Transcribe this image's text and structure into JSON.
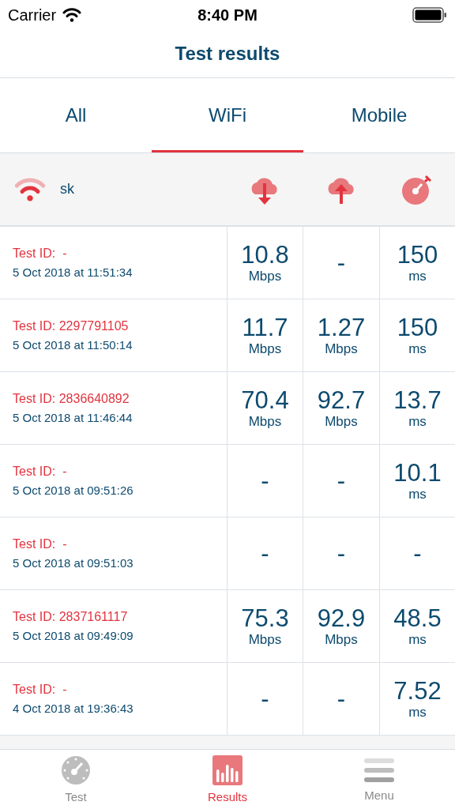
{
  "status_bar": {
    "carrier": "Carrier",
    "time": "8:40 PM"
  },
  "title": "Test results",
  "tabs": [
    {
      "label": "All",
      "selected": false
    },
    {
      "label": "WiFi",
      "selected": true
    },
    {
      "label": "Mobile",
      "selected": false
    }
  ],
  "network": {
    "name": "sk"
  },
  "rows": [
    {
      "test_id": "Test ID:  -",
      "date": "5 Oct 2018 at 11:51:34",
      "cells": [
        {
          "value": "10.8",
          "unit": "Mbps"
        },
        {
          "value": "-"
        },
        {
          "value": "150",
          "unit": "ms"
        }
      ]
    },
    {
      "test_id": "Test ID: 2297791105",
      "date": "5 Oct 2018 at 11:50:14",
      "cells": [
        {
          "value": "11.7",
          "unit": "Mbps"
        },
        {
          "value": "1.27",
          "unit": "Mbps"
        },
        {
          "value": "150",
          "unit": "ms"
        }
      ]
    },
    {
      "test_id": "Test ID: 2836640892",
      "date": "5 Oct 2018 at 11:46:44",
      "cells": [
        {
          "value": "70.4",
          "unit": "Mbps"
        },
        {
          "value": "92.7",
          "unit": "Mbps"
        },
        {
          "value": "13.7",
          "unit": "ms"
        }
      ]
    },
    {
      "test_id": "Test ID:  -",
      "date": "5 Oct 2018 at 09:51:26",
      "cells": [
        {
          "value": "-"
        },
        {
          "value": "-"
        },
        {
          "value": "10.1",
          "unit": "ms"
        }
      ]
    },
    {
      "test_id": "Test ID:  -",
      "date": "5 Oct 2018 at 09:51:03",
      "cells": [
        {
          "value": "-"
        },
        {
          "value": "-"
        },
        {
          "value": "-"
        }
      ]
    },
    {
      "test_id": "Test ID: 2837161117",
      "date": "5 Oct 2018 at 09:49:09",
      "cells": [
        {
          "value": "75.3",
          "unit": "Mbps"
        },
        {
          "value": "92.9",
          "unit": "Mbps"
        },
        {
          "value": "48.5",
          "unit": "ms"
        }
      ]
    },
    {
      "test_id": "Test ID:  -",
      "date": "4 Oct 2018 at 19:36:43",
      "cells": [
        {
          "value": "-"
        },
        {
          "value": "-"
        },
        {
          "value": "7.52",
          "unit": "ms"
        }
      ]
    }
  ],
  "bottom_tabs": [
    {
      "kind": "gauge",
      "label": "Test",
      "selected": false
    },
    {
      "kind": "chart",
      "label": "Results",
      "selected": true
    },
    {
      "kind": "menu",
      "label": "Menu",
      "selected": false
    }
  ]
}
